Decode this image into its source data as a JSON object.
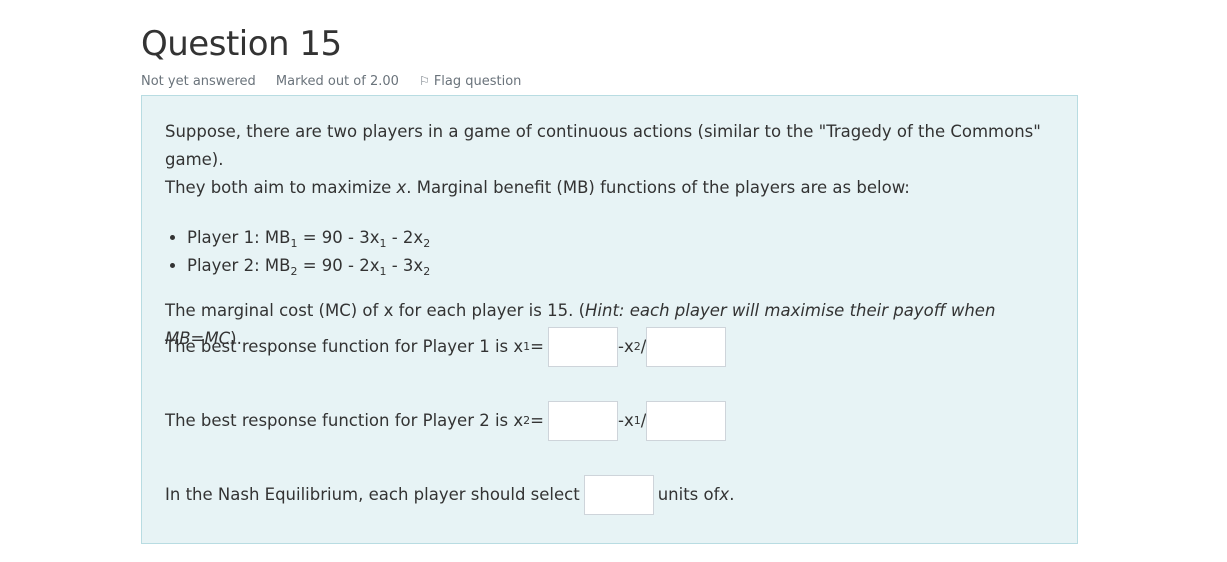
{
  "question": {
    "title": "Question 15",
    "status": "Not yet answered",
    "marked": "Marked out of 2.00",
    "flag_label": "Flag question",
    "flag_icon": "flag-icon"
  },
  "body": {
    "intro_1": "Suppose, there are two players in a game of continuous actions (similar to the \"Tragedy of the Commons\" game).",
    "intro_2a": "They both aim to maximize ",
    "intro_2b": "x",
    "intro_2c": ". Marginal benefit (MB) functions of the players are as below:",
    "p1_prefix": "Player 1: MB",
    "p1_mid": " = 90 - 3x",
    "p1_mid2": " - 2x",
    "p2_prefix": "Player 2: MB",
    "p2_mid": " = 90 - 2x",
    "p2_mid2": " - 3x",
    "sub1": "1",
    "sub2": "2",
    "mc_text": "The marginal cost (MC) of x for each player is 15. (",
    "mc_hint": "Hint: each player will maximise their payoff when MB=MC",
    "mc_close": ").",
    "br1_label": "The best response function for Player 1 is x",
    "br1_eq": " =",
    "br1_mid": "-x",
    "br1_slash": "/",
    "br2_label": "The best response function for Player 2 is x",
    "br2_eq": " =",
    "br2_mid": "-x",
    "br2_slash": "/",
    "ne_label": "In the Nash Equilibrium, each player should select",
    "ne_units": "units of ",
    "ne_x": "x",
    "ne_dot": "."
  },
  "inputs": {
    "br1_a": "",
    "br1_b": "",
    "br2_a": "",
    "br2_b": "",
    "ne": ""
  }
}
